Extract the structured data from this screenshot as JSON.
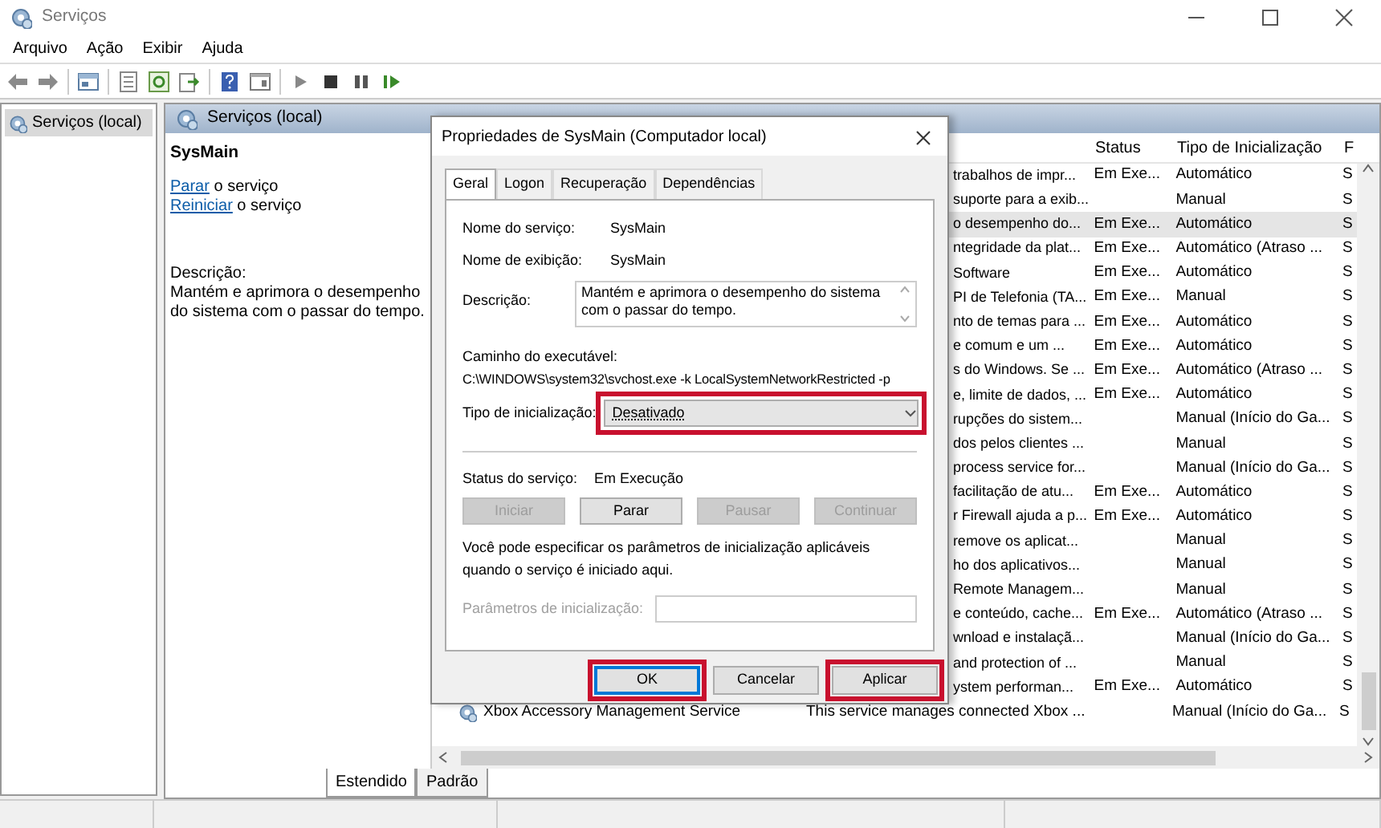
{
  "window": {
    "title": "Serviços"
  },
  "menu": [
    "Arquivo",
    "Ação",
    "Exibir",
    "Ajuda"
  ],
  "tree": [
    {
      "label": "Serviços (local)",
      "selected": true
    }
  ],
  "pane_header": "Serviços (local)",
  "extended": {
    "service_name": "SysMain",
    "actions": [
      {
        "link": "Parar",
        "text": "o serviço"
      },
      {
        "link": "Reiniciar",
        "text": "o serviço"
      }
    ],
    "description_label": "Descrição:",
    "description": "Mantém e aprimora o desempenho do sistema com o passar do tempo."
  },
  "list": {
    "columns": [
      "Status",
      "Tipo de Inicialização",
      "F"
    ],
    "rows": [
      {
        "description": "trabalhos de impr...",
        "status": "Em Exe...",
        "startup": "Automático",
        "logon": "S",
        "selected": false
      },
      {
        "description": "suporte para a exib...",
        "status": "",
        "startup": "Manual",
        "logon": "S",
        "selected": false
      },
      {
        "description": "o desempenho do...",
        "status": "Em Exe...",
        "startup": "Automático",
        "logon": "S",
        "selected": true
      },
      {
        "description": "ntegridade da plat...",
        "status": "Em Exe...",
        "startup": "Automático (Atraso ...",
        "logon": "S",
        "selected": false
      },
      {
        "description": "Software",
        "status": "Em Exe...",
        "startup": "Automático",
        "logon": "S",
        "selected": false
      },
      {
        "description": "PI de Telefonia (TA...",
        "status": "Em Exe...",
        "startup": "Manual",
        "logon": "S",
        "selected": false
      },
      {
        "description": "nto de temas para ...",
        "status": "Em Exe...",
        "startup": "Automático",
        "logon": "S",
        "selected": false
      },
      {
        "description": "e comum e um ...",
        "status": "Em Exe...",
        "startup": "Automático",
        "logon": "S",
        "selected": false
      },
      {
        "description": "s do Windows. Se ...",
        "status": "Em Exe...",
        "startup": "Automático (Atraso ...",
        "logon": "S",
        "selected": false
      },
      {
        "description": "e, limite de dados, ...",
        "status": "Em Exe...",
        "startup": "Automático",
        "logon": "S",
        "selected": false
      },
      {
        "description": "rupções do sistem...",
        "status": "",
        "startup": "Manual (Início do Ga...",
        "logon": "S",
        "selected": false
      },
      {
        "description": "dos pelos clientes ...",
        "status": "",
        "startup": "Manual",
        "logon": "S",
        "selected": false
      },
      {
        "description": "process service for...",
        "status": "",
        "startup": "Manual (Início do Ga...",
        "logon": "S",
        "selected": false
      },
      {
        "description": "facilitação de atu...",
        "status": "Em Exe...",
        "startup": "Automático",
        "logon": "S",
        "selected": false
      },
      {
        "description": "r Firewall ajuda a p...",
        "status": "Em Exe...",
        "startup": "Automático",
        "logon": "S",
        "selected": false
      },
      {
        "description": "remove os aplicat...",
        "status": "",
        "startup": "Manual",
        "logon": "S",
        "selected": false
      },
      {
        "description": "ho dos aplicativos...",
        "status": "",
        "startup": "Manual",
        "logon": "S",
        "selected": false
      },
      {
        "description": "Remote Managem...",
        "status": "",
        "startup": "Manual",
        "logon": "S",
        "selected": false
      },
      {
        "description": "e conteúdo, cache...",
        "status": "Em Exe...",
        "startup": "Automático (Atraso ...",
        "logon": "S",
        "selected": false
      },
      {
        "description": "wnload e instalaçã...",
        "status": "",
        "startup": "Manual (Início do Ga...",
        "logon": "S",
        "selected": false
      },
      {
        "description": "and protection of ...",
        "status": "",
        "startup": "Manual",
        "logon": "S",
        "selected": false
      },
      {
        "description": "ystem performan...",
        "status": "Em Exe...",
        "startup": "Automático",
        "logon": "S",
        "selected": false
      },
      {
        "name": "Xbox Accessory Management Service",
        "description": "This service manages connected Xbox ...",
        "status": "",
        "startup": "Manual (Início do Ga...",
        "logon": "S",
        "selected": false
      }
    ]
  },
  "view_tabs": [
    {
      "label": "Estendido",
      "selected": true
    },
    {
      "label": "Padrão",
      "selected": false
    }
  ],
  "dialog": {
    "title": "Propriedades de SysMain (Computador local)",
    "tabs": [
      {
        "label": "Geral",
        "selected": true
      },
      {
        "label": "Logon",
        "selected": false
      },
      {
        "label": "Recuperação",
        "selected": false
      },
      {
        "label": "Dependências",
        "selected": false
      }
    ],
    "fields": [
      {
        "label": "Nome do serviço:",
        "value": "SysMain"
      },
      {
        "label": "Nome de exibição:",
        "value": "SysMain"
      }
    ],
    "description_label": "Descrição:",
    "description": "Mantém e aprimora o desempenho do sistema com o passar do tempo.",
    "path_label": "Caminho do executável:",
    "path": "C:\\WINDOWS\\system32\\svchost.exe -k LocalSystemNetworkRestricted -p",
    "startup_label": "Tipo de inicialização:",
    "startup_value": "Desativado",
    "startup_highlighted": true,
    "status_label": "Status do serviço:",
    "status_value": "Em Execução",
    "service_buttons": [
      {
        "label": "Iniciar",
        "disabled": true
      },
      {
        "label": "Parar",
        "disabled": false
      },
      {
        "label": "Pausar",
        "disabled": true
      },
      {
        "label": "Continuar",
        "disabled": true
      }
    ],
    "params_note": "Você pode especificar os parâmetros de inicialização aplicáveis quando o serviço é iniciado aqui.",
    "params_label": "Parâmetros de inicialização:",
    "params_disabled": true,
    "buttons": [
      {
        "label": "OK",
        "highlighted": true,
        "default": true
      },
      {
        "label": "Cancelar",
        "highlighted": false,
        "default": false
      },
      {
        "label": "Aplicar",
        "highlighted": true,
        "default": false
      }
    ]
  }
}
